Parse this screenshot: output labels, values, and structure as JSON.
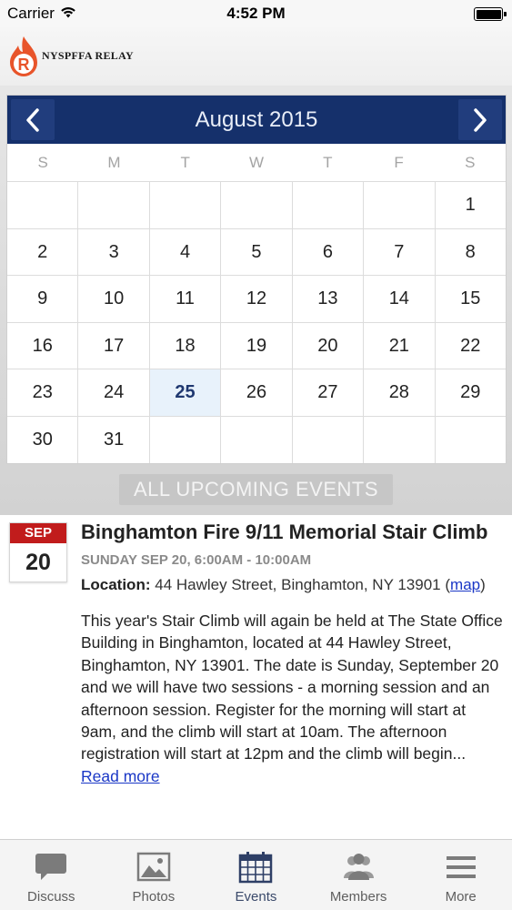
{
  "status_bar": {
    "carrier": "Carrier",
    "time": "4:52 PM"
  },
  "header": {
    "logo_letter": "R",
    "logo_text": "NYSPFFA RELAY"
  },
  "colors": {
    "header_navy": "#15306b",
    "badge_red": "#c11c1c",
    "today_bg": "#e8f2fb",
    "link_blue": "#1a37c6",
    "logo_orange": "#e8542a"
  },
  "calendar": {
    "month_title": "August 2015",
    "prev_icon": "chevron-left-icon",
    "next_icon": "chevron-right-icon",
    "weekdays": [
      "S",
      "M",
      "T",
      "W",
      "T",
      "F",
      "S"
    ],
    "weeks": [
      [
        "",
        "",
        "",
        "",
        "",
        "",
        "1"
      ],
      [
        "2",
        "3",
        "4",
        "5",
        "6",
        "7",
        "8"
      ],
      [
        "9",
        "10",
        "11",
        "12",
        "13",
        "14",
        "15"
      ],
      [
        "16",
        "17",
        "18",
        "19",
        "20",
        "21",
        "22"
      ],
      [
        "23",
        "24",
        "25",
        "26",
        "27",
        "28",
        "29"
      ],
      [
        "30",
        "31",
        "",
        "",
        "",
        "",
        ""
      ]
    ],
    "today": "25",
    "upcoming_label": "ALL UPCOMING EVENTS"
  },
  "event": {
    "month": "SEP",
    "day": "20",
    "title": "Binghamton Fire 9/11 Memorial Stair Climb",
    "time": "SUNDAY SEP 20, 6:00AM - 10:00AM",
    "location_label": "Location:",
    "location": "44 Hawley Street, Binghamton, NY 13901",
    "map_open": "(",
    "map_link": "map",
    "map_close": ")",
    "description": "This year's Stair Climb will again be held at The State Office Building in Binghamton, located at 44 Hawley Street, Binghamton, NY 13901. The date is Sunday, September 20 and we will have two sessions - a morning session and an afternoon session. Register for the morning will start at 9am, and the climb will start at 10am. The afternoon registration will start at 12pm and the climb will begin...",
    "read_more": "Read more"
  },
  "tabs": [
    {
      "label": "Discuss",
      "icon": "chat-bubble-icon"
    },
    {
      "label": "Photos",
      "icon": "photo-icon"
    },
    {
      "label": "Events",
      "icon": "calendar-icon"
    },
    {
      "label": "Members",
      "icon": "people-icon"
    },
    {
      "label": "More",
      "icon": "menu-icon"
    }
  ]
}
